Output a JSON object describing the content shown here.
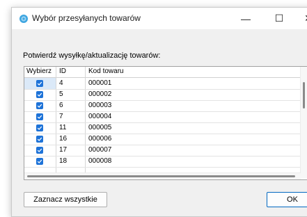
{
  "window": {
    "title": "Wybór przesyłanych towarów",
    "controls": {
      "minimize": "—",
      "maximize": "☐",
      "close": "✕"
    }
  },
  "prompt": "Potwierdź wysyłkę/aktualizację towarów:",
  "grid": {
    "columns": [
      "Wybierz",
      "ID",
      "Kod towaru"
    ],
    "rows": [
      {
        "checked": true,
        "id": "4",
        "kod": "000001"
      },
      {
        "checked": true,
        "id": "5",
        "kod": "000002"
      },
      {
        "checked": true,
        "id": "6",
        "kod": "000003"
      },
      {
        "checked": true,
        "id": "7",
        "kod": "000004"
      },
      {
        "checked": true,
        "id": "11",
        "kod": "000005"
      },
      {
        "checked": true,
        "id": "16",
        "kod": "000006"
      },
      {
        "checked": true,
        "id": "17",
        "kod": "000007"
      },
      {
        "checked": true,
        "id": "18",
        "kod": "000008"
      }
    ]
  },
  "buttons": {
    "select_all": "Zaznacz wszystkie",
    "ok": "OK"
  },
  "colors": {
    "checkbox": "#1e73d8",
    "selection": "#dbe9f8",
    "accent": "#0067c0"
  }
}
